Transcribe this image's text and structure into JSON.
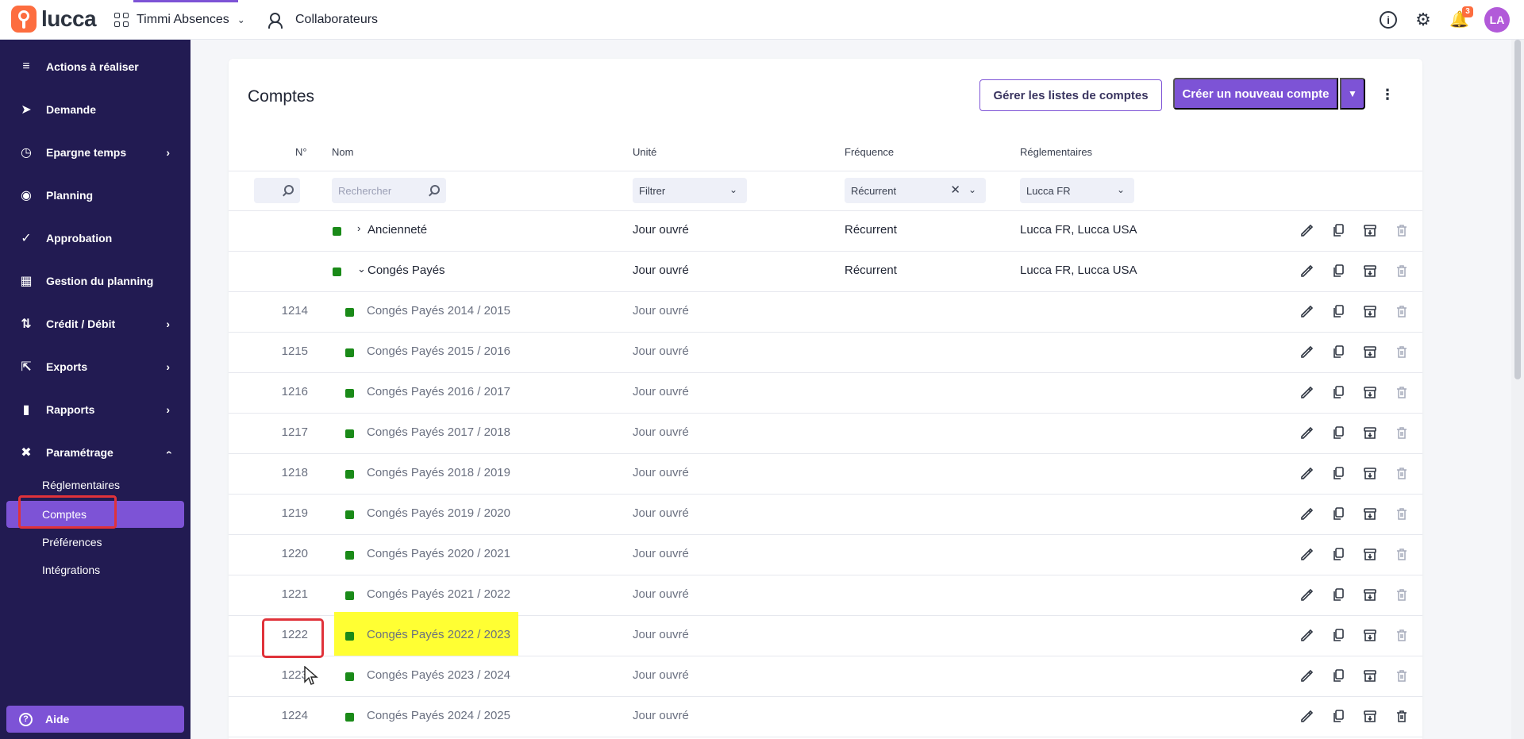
{
  "header": {
    "logo_text": "lucca",
    "app_name": "Timmi Absences",
    "collab_label": "Collaborateurs",
    "notif_count": "3",
    "avatar_initials": "LA"
  },
  "sidebar": {
    "items": [
      {
        "label": "Actions à réaliser",
        "icon": "list-check-icon",
        "chevron": false
      },
      {
        "label": "Demande",
        "icon": "send-icon",
        "chevron": false
      },
      {
        "label": "Epargne temps",
        "icon": "clock-icon",
        "chevron": true
      },
      {
        "label": "Planning",
        "icon": "eye-icon",
        "chevron": false
      },
      {
        "label": "Approbation",
        "icon": "check-icon",
        "chevron": false
      },
      {
        "label": "Gestion du planning",
        "icon": "calendar-gear-icon",
        "chevron": false
      },
      {
        "label": "Crédit / Débit",
        "icon": "sort-arrows-icon",
        "chevron": true
      },
      {
        "label": "Exports",
        "icon": "export-icon",
        "chevron": true
      },
      {
        "label": "Rapports",
        "icon": "bar-chart-icon",
        "chevron": true
      },
      {
        "label": "Paramétrage",
        "icon": "tools-icon",
        "chevron": true
      }
    ],
    "sub_items": [
      "Réglementaires",
      "Comptes",
      "Préférences",
      "Intégrations"
    ],
    "active_sub": "Comptes",
    "help_label": "Aide"
  },
  "main": {
    "title": "Comptes",
    "manage_lists_label": "Gérer les listes de comptes",
    "create_label": "Créer un nouveau compte",
    "columns": [
      "N°",
      "Nom",
      "Unité",
      "Fréquence",
      "Réglementaires"
    ],
    "filters": {
      "search_placeholder": "Rechercher",
      "unit_filter": "Filtrer",
      "frequency_filter": "Récurrent",
      "regulation_filter": "Lucca FR"
    },
    "rows": [
      {
        "num": "",
        "name": "Ancienneté",
        "unit": "Jour ouvré",
        "frequency": "Récurrent",
        "regulation": "Lucca FR, Lucca USA",
        "parent": true,
        "expanded": false
      },
      {
        "num": "",
        "name": "Congés Payés",
        "unit": "Jour ouvré",
        "frequency": "Récurrent",
        "regulation": "Lucca FR, Lucca USA",
        "parent": true,
        "expanded": true
      },
      {
        "num": "1214",
        "name": "Congés Payés 2014 / 2015",
        "unit": "Jour ouvré",
        "frequency": "",
        "regulation": "",
        "parent": false
      },
      {
        "num": "1215",
        "name": "Congés Payés 2015 / 2016",
        "unit": "Jour ouvré",
        "frequency": "",
        "regulation": "",
        "parent": false
      },
      {
        "num": "1216",
        "name": "Congés Payés 2016 / 2017",
        "unit": "Jour ouvré",
        "frequency": "",
        "regulation": "",
        "parent": false
      },
      {
        "num": "1217",
        "name": "Congés Payés 2017 / 2018",
        "unit": "Jour ouvré",
        "frequency": "",
        "regulation": "",
        "parent": false
      },
      {
        "num": "1218",
        "name": "Congés Payés 2018 / 2019",
        "unit": "Jour ouvré",
        "frequency": "",
        "regulation": "",
        "parent": false
      },
      {
        "num": "1219",
        "name": "Congés Payés 2019 / 2020",
        "unit": "Jour ouvré",
        "frequency": "",
        "regulation": "",
        "parent": false
      },
      {
        "num": "1220",
        "name": "Congés Payés 2020 / 2021",
        "unit": "Jour ouvré",
        "frequency": "",
        "regulation": "",
        "parent": false
      },
      {
        "num": "1221",
        "name": "Congés Payés 2021 / 2022",
        "unit": "Jour ouvré",
        "frequency": "",
        "regulation": "",
        "parent": false
      },
      {
        "num": "1222",
        "name": "Congés Payés 2022 / 2023",
        "unit": "Jour ouvré",
        "frequency": "",
        "regulation": "",
        "parent": false,
        "highlighted": true
      },
      {
        "num": "1223",
        "name": "Congés Payés 2023 / 2024",
        "unit": "Jour ouvré",
        "frequency": "",
        "regulation": "",
        "parent": false
      },
      {
        "num": "1224",
        "name": "Congés Payés 2024 / 2025",
        "unit": "Jour ouvré",
        "frequency": "",
        "regulation": "",
        "parent": false
      }
    ]
  },
  "colors": {
    "accent": "#7d53d6",
    "sidebar_bg": "#221b52",
    "brand_orange": "#fd6d3f",
    "status_green": "#1a8a18",
    "annotation_red": "#e0323a",
    "highlight_yellow": "#ffff33"
  }
}
